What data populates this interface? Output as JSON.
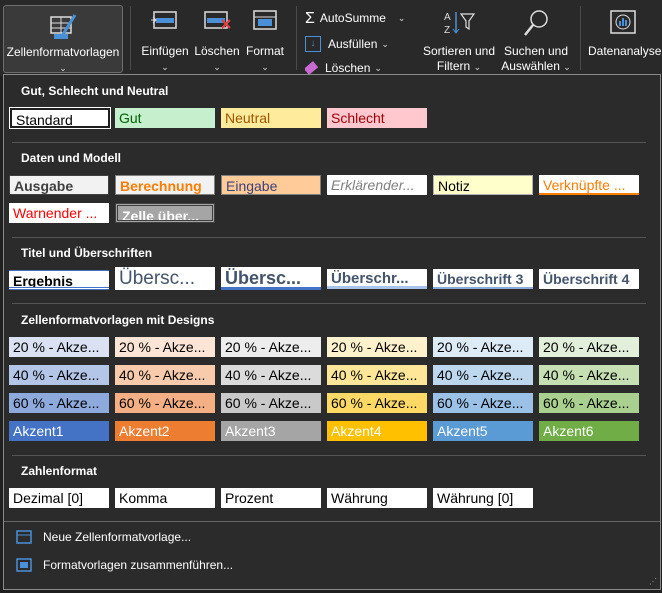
{
  "ribbon": {
    "format_templates": "Zellenformatvorlagen",
    "insert": "Einfügen",
    "delete": "Löschen",
    "format": "Format",
    "autosum": "AutoSumme",
    "fill": "Ausfüllen",
    "clear": "Löschen",
    "sort_filter_1": "Sortieren und",
    "sort_filter_2": "Filtern",
    "find_select_1": "Suchen und",
    "find_select_2": "Auswählen",
    "data_analysis": "Datenanalyse"
  },
  "sections": {
    "good_bad": "Gut, Schlecht und Neutral",
    "data_model": "Daten und Modell",
    "titles": "Titel und Überschriften",
    "themed": "Zellenformatvorlagen mit Designs",
    "number_format": "Zahlenformat"
  },
  "styles": {
    "standard": "Standard",
    "gut": "Gut",
    "neutral": "Neutral",
    "schlecht": "Schlecht",
    "ausgabe": "Ausgabe",
    "berechnung": "Berechnung",
    "eingabe": "Eingabe",
    "erklaerender": "Erklärender...",
    "notiz": "Notiz",
    "verknuepfte": "Verknüpfte ...",
    "warnender": "Warnender ...",
    "zelle_ueber": "Zelle über...",
    "ergebnis": "Ergebnis",
    "ueberschrift_big": "Übersc...",
    "ueberschrift_1": "Übersc...",
    "ueberschrift_2": "Überschr...",
    "ueberschrift_3": "Überschrift 3",
    "ueberschrift_4": "Überschrift 4"
  },
  "accents": {
    "row20": [
      "20 % - Akze...",
      "20 % - Akze...",
      "20 % - Akze...",
      "20 % - Akze...",
      "20 % - Akze...",
      "20 % - Akze..."
    ],
    "row40": [
      "40 % - Akze...",
      "40 % - Akze...",
      "40 % - Akze...",
      "40 % - Akze...",
      "40 % - Akze...",
      "40 % - Akze..."
    ],
    "row60": [
      "60 % - Akze...",
      "60 % - Akze...",
      "60 % - Akze...",
      "60 % - Akze...",
      "60 % - Akze...",
      "60 % - Akze..."
    ],
    "full": [
      "Akzent1",
      "Akzent2",
      "Akzent3",
      "Akzent4",
      "Akzent5",
      "Akzent6"
    ]
  },
  "number_styles": [
    "Dezimal [0]",
    "Komma",
    "Prozent",
    "Währung",
    "Währung [0]"
  ],
  "commands": {
    "new_style": "Neue Zellenformatvorlage...",
    "merge_styles": "Formatvorlagen zusammenführen..."
  },
  "icons": {
    "format_templates": "paintbrush-table-icon",
    "insert": "insert-cells-icon",
    "delete": "delete-cells-icon",
    "format": "format-cells-icon",
    "autosum": "sigma-icon",
    "fill": "fill-down-icon",
    "clear": "eraser-icon",
    "sort_filter": "sort-filter-icon",
    "find_select": "magnifier-icon",
    "data_analysis": "data-analysis-icon",
    "new_style": "cell-style-icon",
    "merge_styles": "merge-styles-icon"
  },
  "colors": {
    "accent1": "#4472c4",
    "accent2": "#ed7d31",
    "accent3": "#a5a5a5",
    "accent4": "#ffc000",
    "accent5": "#5b9bd5",
    "accent6": "#70ad47"
  }
}
